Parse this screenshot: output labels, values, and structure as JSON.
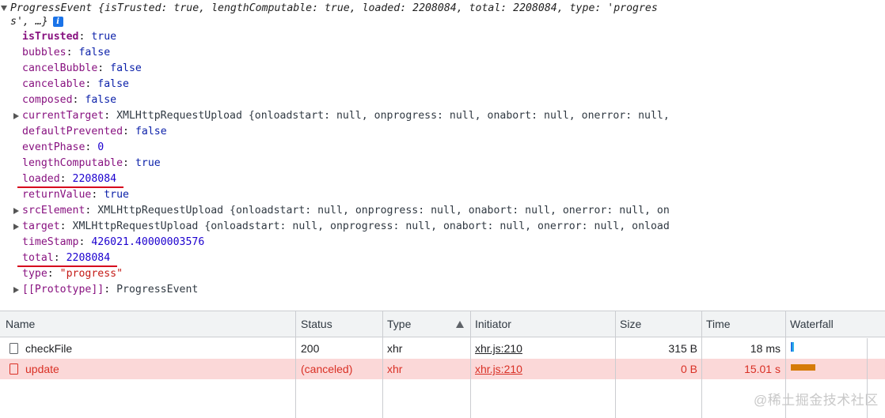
{
  "console": {
    "summary_line1": "ProgressEvent {isTrusted: true, lengthComputable: true, loaded: 2208084, total: 2208084, type: 'progres",
    "summary_line2": "s', …}",
    "info_badge": "i",
    "props": [
      {
        "key": "isTrusted",
        "value": "true",
        "kind": "bool"
      },
      {
        "key": "bubbles",
        "value": "false",
        "kind": "bool"
      },
      {
        "key": "cancelBubble",
        "value": "false",
        "kind": "bool"
      },
      {
        "key": "cancelable",
        "value": "false",
        "kind": "bool"
      },
      {
        "key": "composed",
        "value": "false",
        "kind": "bool"
      },
      {
        "key": "currentTarget",
        "value": "XMLHttpRequestUpload {onloadstart: null, onprogress: null, onabort: null, onerror: null,",
        "kind": "obj"
      },
      {
        "key": "defaultPrevented",
        "value": "false",
        "kind": "bool"
      },
      {
        "key": "eventPhase",
        "value": "0",
        "kind": "num"
      },
      {
        "key": "lengthComputable",
        "value": "true",
        "kind": "bool"
      },
      {
        "key": "loaded",
        "value": "2208084",
        "kind": "num"
      },
      {
        "key": "returnValue",
        "value": "true",
        "kind": "bool"
      },
      {
        "key": "srcElement",
        "value": "XMLHttpRequestUpload {onloadstart: null, onprogress: null, onabort: null, onerror: null, on",
        "kind": "obj"
      },
      {
        "key": "target",
        "value": "XMLHttpRequestUpload {onloadstart: null, onprogress: null, onabort: null, onerror: null, onload",
        "kind": "obj"
      },
      {
        "key": "timeStamp",
        "value": "426021.40000003576",
        "kind": "num"
      },
      {
        "key": "total",
        "value": "2208084",
        "kind": "num"
      },
      {
        "key": "type",
        "value": "\"progress\"",
        "kind": "str"
      },
      {
        "key": "[[Prototype]]",
        "value": "ProgressEvent",
        "kind": "obj"
      }
    ]
  },
  "network": {
    "columns": {
      "name": "Name",
      "status": "Status",
      "type": "Type",
      "initiator": "Initiator",
      "size": "Size",
      "time": "Time",
      "waterfall": "Waterfall"
    },
    "rows": [
      {
        "name": "checkFile",
        "status": "200",
        "type": "xhr",
        "initiator": "xhr.js:210",
        "size": "315 B",
        "time": "18 ms"
      },
      {
        "name": "update",
        "status": "(canceled)",
        "type": "xhr",
        "initiator": "xhr.js:210",
        "size": "0 B",
        "time": "15.01 s"
      }
    ]
  },
  "colors": {
    "underline": "#d6001c",
    "error_row_bg": "#fbd8d8",
    "error_text": "#d93025",
    "waterfall_ok": "#1a73e8",
    "waterfall_canceled": "#d57b08"
  },
  "watermark": "@稀土掘金技术社区"
}
